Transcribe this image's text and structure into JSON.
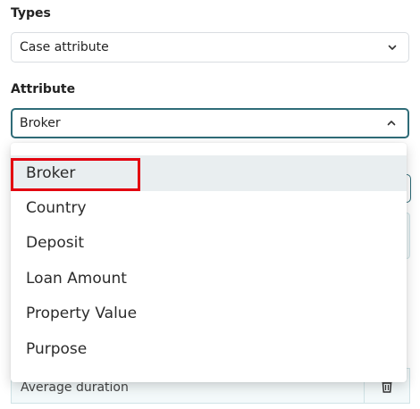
{
  "types": {
    "label": "Types",
    "selected": "Case attribute"
  },
  "attribute": {
    "label": "Attribute",
    "selected": "Broker"
  },
  "dropdown": {
    "options": [
      {
        "label": "Broker",
        "active": true
      },
      {
        "label": "Country",
        "active": false
      },
      {
        "label": "Deposit",
        "active": false
      },
      {
        "label": "Loan Amount",
        "active": false
      },
      {
        "label": "Property Value",
        "active": false
      },
      {
        "label": "Purpose",
        "active": false
      }
    ]
  },
  "background": {
    "average_duration_label": "Average duration"
  },
  "colors": {
    "focus_border": "#2f6c78",
    "highlight_annotation": "#e3000f",
    "active_option_bg": "#e9eef0"
  },
  "icons": {
    "types_chevron": "chevron-down-icon",
    "attribute_chevron": "chevron-up-icon",
    "delete": "trash-icon"
  }
}
